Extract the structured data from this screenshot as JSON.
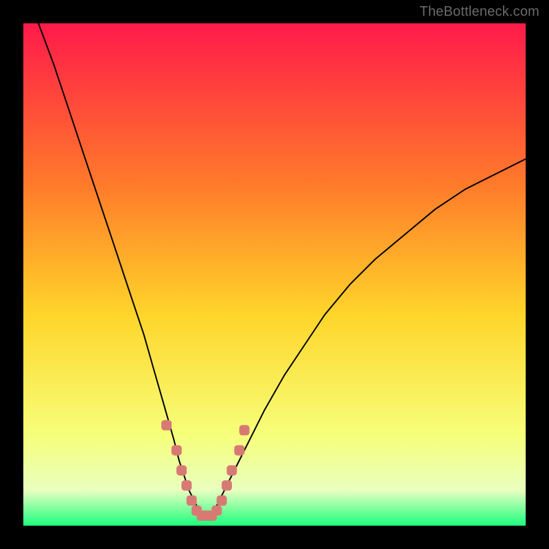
{
  "watermark": {
    "text": "TheBottleneck.com"
  },
  "colors": {
    "frame": "#000000",
    "gradient_top": "#ff1a4a",
    "gradient_mid_top": "#ff7a2a",
    "gradient_mid": "#ffd52a",
    "gradient_mid_bottom": "#f6ff7a",
    "gradient_low": "#e8ffbf",
    "gradient_base": "#1dff7e",
    "curve": "#000000",
    "marker_fill": "#d87a74",
    "marker_stroke": "#d87a74"
  },
  "chart_data": {
    "type": "line",
    "title": "",
    "xlabel": "",
    "ylabel": "",
    "xlim": [
      0,
      100
    ],
    "ylim": [
      0,
      100
    ],
    "grid": false,
    "legend": false,
    "series": [
      {
        "name": "bottleneck-curve",
        "x": [
          3,
          6,
          9,
          12,
          15,
          18,
          21,
          24,
          26,
          28,
          30,
          31,
          32,
          33,
          34,
          35,
          36,
          37,
          38,
          39,
          40,
          42,
          45,
          48,
          52,
          56,
          60,
          65,
          70,
          76,
          82,
          88,
          94,
          100
        ],
        "y": [
          100,
          92,
          83,
          74,
          65,
          56,
          47,
          38,
          31,
          24,
          17,
          13,
          10,
          7,
          5,
          3,
          2,
          2,
          3,
          5,
          7,
          11,
          17,
          23,
          30,
          36,
          42,
          48,
          53,
          58,
          63,
          67,
          70,
          73
        ]
      }
    ],
    "markers": {
      "name": "curve-sample-markers",
      "x": [
        28.5,
        30.5,
        31.5,
        32.5,
        33.5,
        34.5,
        35.5,
        36.5,
        37.5,
        38.5,
        39.5,
        40.5,
        41.5,
        43.0,
        44.0
      ],
      "y": [
        20,
        15,
        11,
        8,
        5,
        3,
        2,
        2,
        2,
        3,
        5,
        8,
        11,
        15,
        19
      ]
    }
  }
}
